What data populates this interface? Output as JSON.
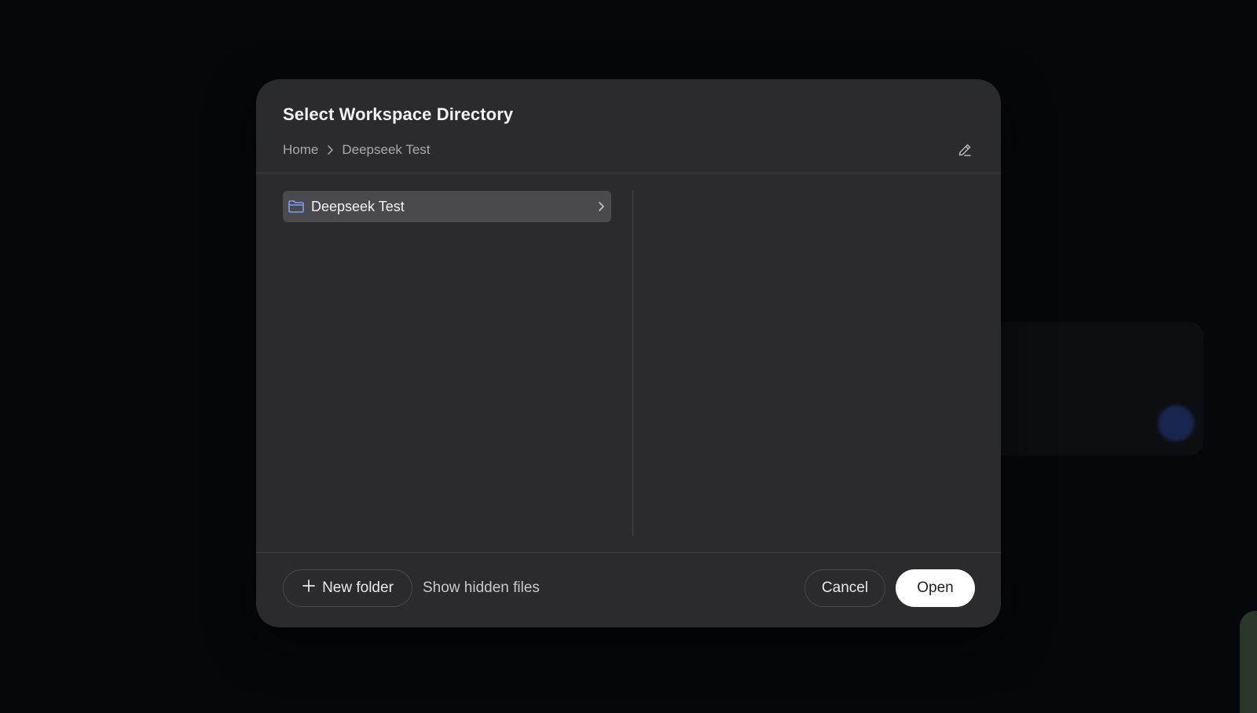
{
  "dialog": {
    "title": "Select Workspace Directory",
    "breadcrumb": [
      "Home",
      "Deepseek Test"
    ],
    "edit_icon": "pencil-icon"
  },
  "folders": [
    {
      "name": "Deepseek Test",
      "icon": "folder-icon",
      "selected": true
    }
  ],
  "footer": {
    "new_folder_label": "New folder",
    "show_hidden_label": "Show hidden files",
    "cancel_label": "Cancel",
    "open_label": "Open"
  },
  "colors": {
    "dialog_bg": "#2b2b2e",
    "selected_row": "#4a4a4e",
    "folder_icon": "#7c9ef0",
    "primary_button": "#ffffff"
  }
}
